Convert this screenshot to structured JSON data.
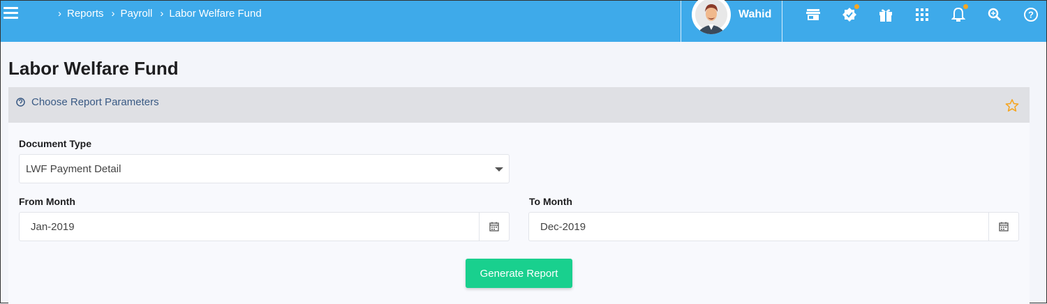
{
  "breadcrumb": {
    "items": [
      "Reports",
      "Payroll",
      "Labor Welfare Fund"
    ]
  },
  "user": {
    "name": "Wahid"
  },
  "toolbar_icons": [
    "store-icon",
    "verified-badge-icon",
    "gift-icon",
    "apps-grid-icon",
    "bell-icon",
    "search-zoom-icon",
    "help-icon"
  ],
  "page": {
    "title": "Labor Welfare Fund"
  },
  "panel": {
    "title": "Choose Report Parameters"
  },
  "form": {
    "document_type_label": "Document Type",
    "document_type_value": "LWF Payment Detail",
    "from_month_label": "From Month",
    "from_month_value": "Jan-2019",
    "to_month_label": "To Month",
    "to_month_value": "Dec-2019",
    "generate_label": "Generate Report"
  },
  "colors": {
    "topbar": "#3eaaea",
    "notification_dot": "#f5a623",
    "primary_button": "#19d08e",
    "star": "#f5a623"
  }
}
